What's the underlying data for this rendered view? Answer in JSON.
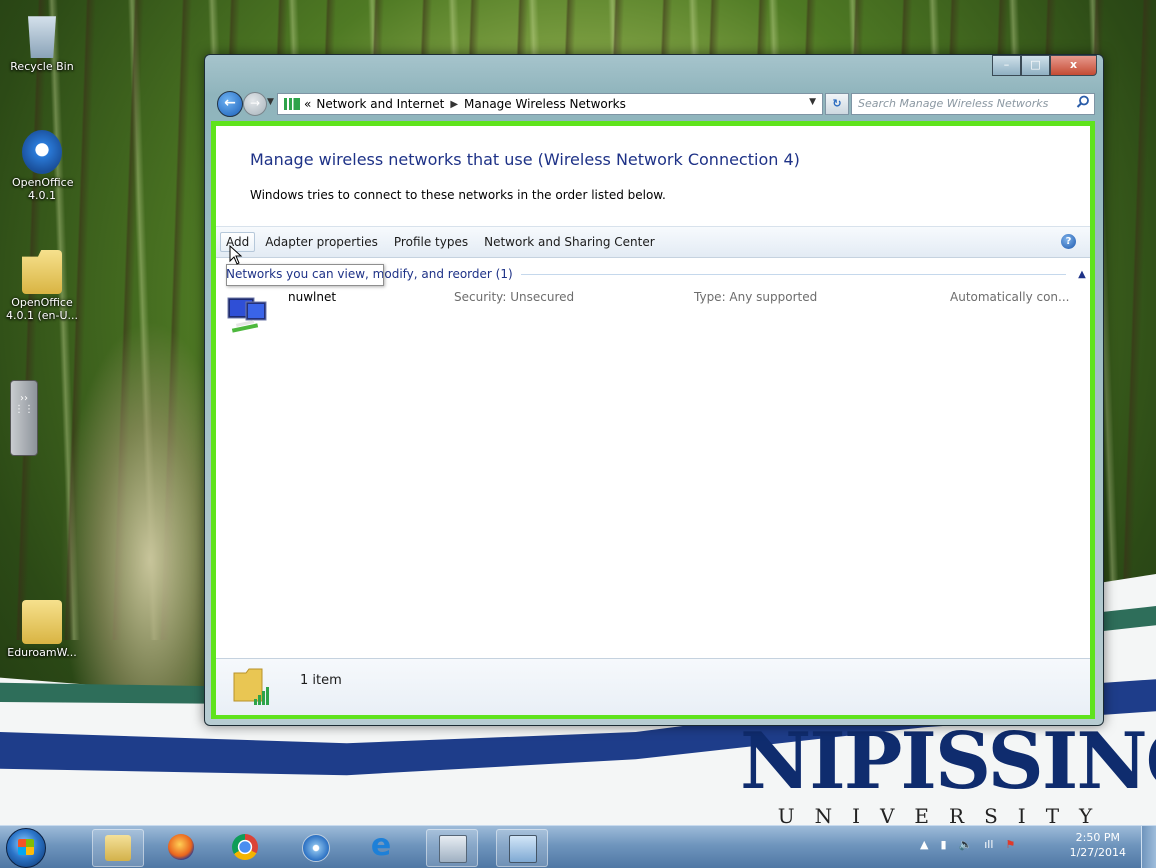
{
  "desktop": {
    "icons": [
      {
        "label": "Recycle Bin"
      },
      {
        "label": "OpenOffice 4.0.1"
      },
      {
        "label": "OpenOffice 4.0.1 (en-U..."
      },
      {
        "label": "EduroamW..."
      }
    ],
    "brand": {
      "name": "NIPISSING",
      "sub": "UNIVERSITY"
    }
  },
  "window": {
    "buttons": {
      "minimize": "–",
      "maximize": "□",
      "close": "x"
    },
    "address": {
      "breadcrumbs": [
        "Network and Internet",
        "Manage Wireless Networks"
      ],
      "overflow": "«"
    },
    "search": {
      "placeholder": "Search Manage Wireless Networks"
    },
    "title": "Manage wireless networks that use (Wireless Network Connection 4)",
    "description": "Windows tries to connect to these networks in the order listed below.",
    "toolbar": {
      "add": "Add",
      "adapter_properties": "Adapter properties",
      "profile_types": "Profile types",
      "network_sharing_center": "Network and Sharing Center",
      "help": "?"
    },
    "group": {
      "label": "Networks you can view, modify, and reorder (1)"
    },
    "networks": [
      {
        "name": "nuwlnet",
        "security": "Security: Unsecured",
        "type": "Type: Any supported",
        "connect": "Automatically con..."
      }
    ],
    "status": {
      "items": "1 item"
    }
  },
  "taskbar": {
    "clock_time": "2:50 PM",
    "clock_date": "1/27/2014"
  },
  "colors": {
    "highlight_border": "#5fe31c",
    "title_blue": "#1e3287"
  }
}
